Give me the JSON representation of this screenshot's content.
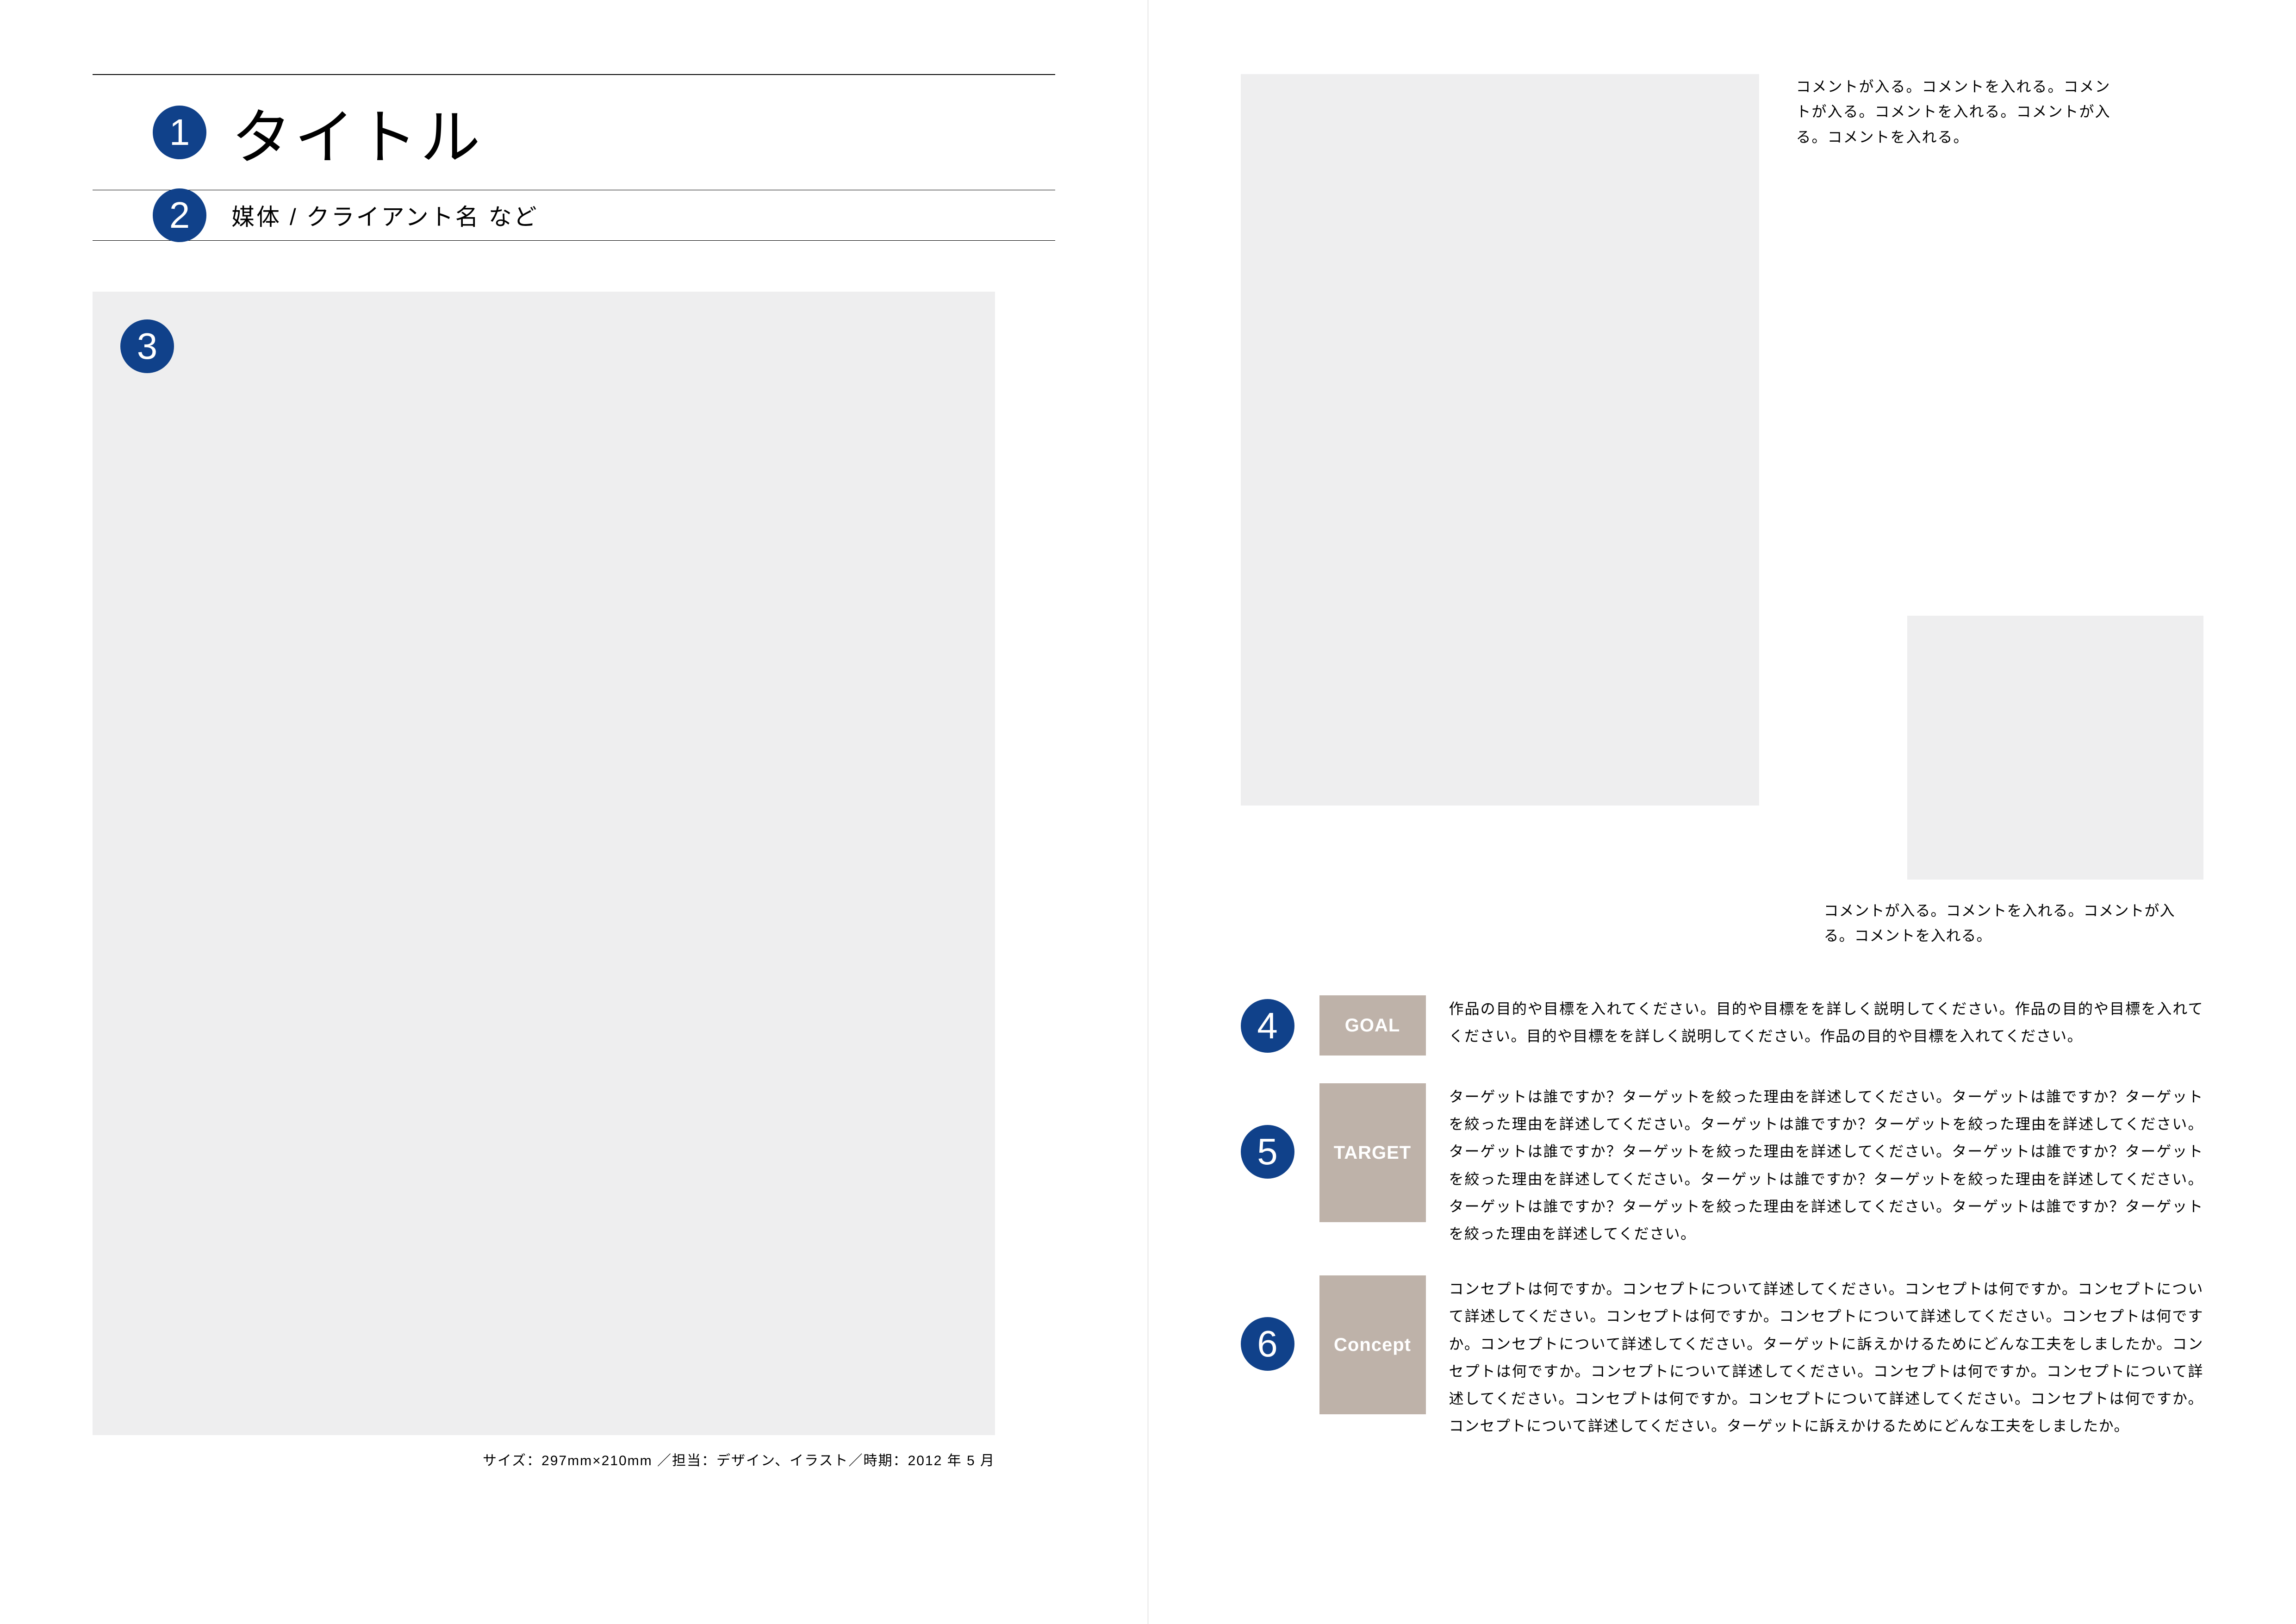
{
  "badges": {
    "b1": "1",
    "b2": "2",
    "b3": "3",
    "b4": "4",
    "b5": "5",
    "b6": "6"
  },
  "left": {
    "title": "タイトル",
    "subtitle": "媒体 / クライアント名 など",
    "meta": "サイズ：297mm×210mm ／担当：デザイン、イラスト／時期：2012 年 5 月"
  },
  "right": {
    "comment_top": "コメントが入る。コメントを入れる。コメントが入る。コメントを入れる。コメントが入る。コメントを入れる。",
    "comment_bottom": "コメントが入る。コメントを入れる。コメントが入る。コメントを入れる。",
    "sections": {
      "goal": {
        "label": "GOAL",
        "body": "作品の目的や目標を入れてください。目的や目標をを詳しく説明してください。作品の目的や目標を入れてください。目的や目標をを詳しく説明してください。作品の目的や目標を入れてください。"
      },
      "target": {
        "label": "TARGET",
        "body": "ターゲットは誰ですか？ターゲットを絞った理由を詳述してください。ターゲットは誰ですか？ターゲットを絞った理由を詳述してください。ターゲットは誰ですか？ターゲットを絞った理由を詳述してください。ターゲットは誰ですか？ターゲットを絞った理由を詳述してください。ターゲットは誰ですか？ターゲットを絞った理由を詳述してください。ターゲットは誰ですか？ターゲットを絞った理由を詳述してください。ターゲットは誰ですか？ターゲットを絞った理由を詳述してください。ターゲットは誰ですか？ターゲットを絞った理由を詳述してください。"
      },
      "concept": {
        "label": "Concept",
        "body": "コンセプトは何ですか。コンセプトについて詳述してください。コンセプトは何ですか。コンセプトについて詳述してください。コンセプトは何ですか。コンセプトについて詳述してください。コンセプトは何ですか。コンセプトについて詳述してください。ターゲットに訴えかけるためにどんな工夫をしましたか。コンセプトは何ですか。コンセプトについて詳述してください。コンセプトは何ですか。コンセプトについて詳述してください。コンセプトは何ですか。コンセプトについて詳述してください。コンセプトは何ですか。コンセプトについて詳述してください。ターゲットに訴えかけるためにどんな工夫をしましたか。"
      }
    }
  }
}
